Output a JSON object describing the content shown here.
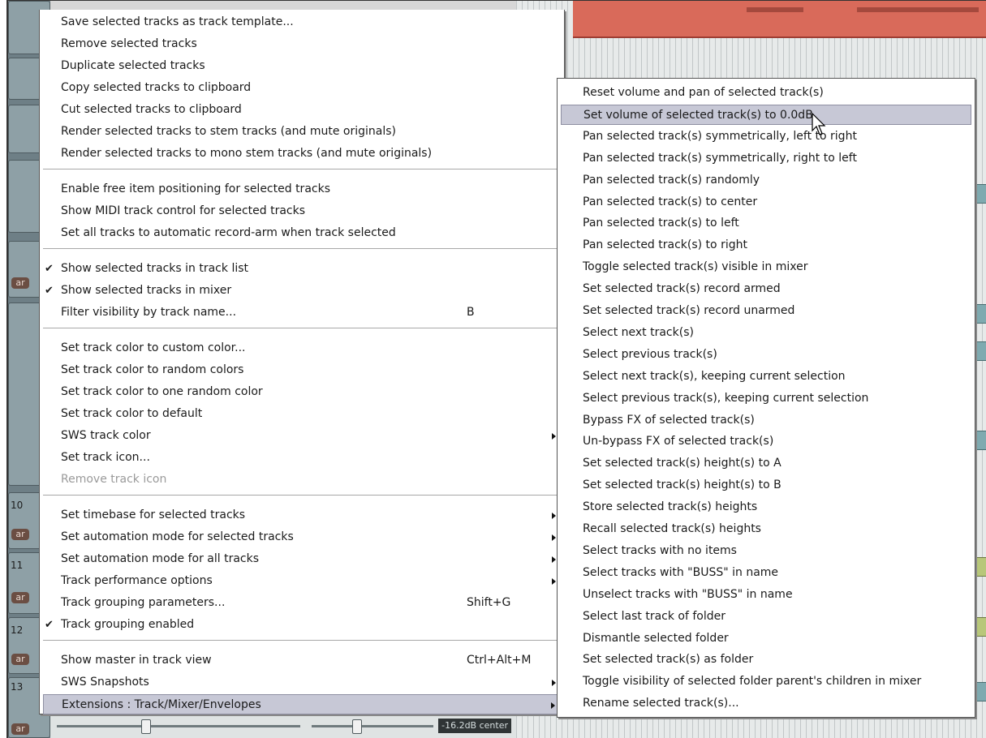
{
  "tcp": {
    "track_numbers": [
      "10",
      "11",
      "12",
      "13"
    ],
    "arm_label": "ar"
  },
  "bottom_strip": {
    "readout": "-16.2dB center"
  },
  "main_menu": {
    "items": [
      {
        "label": "Save selected tracks as track template..."
      },
      {
        "label": "Remove selected tracks"
      },
      {
        "label": "Duplicate selected tracks"
      },
      {
        "label": "Copy selected tracks to clipboard"
      },
      {
        "label": "Cut selected tracks to clipboard"
      },
      {
        "label": "Render selected tracks to stem tracks (and mute originals)"
      },
      {
        "label": "Render selected tracks to mono stem tracks (and mute originals)"
      },
      {
        "label": "Enable free item positioning for selected tracks"
      },
      {
        "label": "Show MIDI track control for selected tracks"
      },
      {
        "label": "Set all tracks to automatic record-arm when track selected"
      },
      {
        "label": "Show selected tracks in track list",
        "checked": true
      },
      {
        "label": "Show selected tracks in mixer",
        "checked": true
      },
      {
        "label": "Filter visibility by track name...",
        "shortcut": "B"
      },
      {
        "label": "Set track color to custom color..."
      },
      {
        "label": "Set track color to random colors"
      },
      {
        "label": "Set track color to one random color"
      },
      {
        "label": "Set track color to default"
      },
      {
        "label": "SWS track color",
        "submenu": true
      },
      {
        "label": "Set track icon..."
      },
      {
        "label": "Remove track icon",
        "disabled": true
      },
      {
        "label": "Set timebase for selected tracks",
        "submenu": true
      },
      {
        "label": "Set automation mode for selected tracks",
        "submenu": true
      },
      {
        "label": "Set automation mode for all tracks",
        "submenu": true
      },
      {
        "label": "Track performance options",
        "submenu": true
      },
      {
        "label": "Track grouping parameters...",
        "shortcut": "Shift+G"
      },
      {
        "label": "Track grouping enabled",
        "checked": true
      },
      {
        "label": "Show master in track view",
        "shortcut": "Ctrl+Alt+M"
      },
      {
        "label": "SWS Snapshots",
        "submenu": true
      },
      {
        "label": "Extensions : Track/Mixer/Envelopes",
        "submenu": true,
        "highlighted": true
      }
    ],
    "checkmark_glyph": "✔"
  },
  "sub_menu": {
    "items": [
      {
        "label": "Reset volume and pan of selected track(s)"
      },
      {
        "label": "Set volume of selected track(s) to 0.0dB",
        "highlighted": true
      },
      {
        "label": "Pan selected track(s) symmetrically, left to right"
      },
      {
        "label": "Pan selected track(s) symmetrically, right to left"
      },
      {
        "label": "Pan selected track(s) randomly"
      },
      {
        "label": "Pan selected track(s) to center"
      },
      {
        "label": "Pan selected track(s) to left"
      },
      {
        "label": "Pan selected track(s) to right"
      },
      {
        "label": "Toggle selected track(s) visible in mixer"
      },
      {
        "label": "Set selected track(s) record armed"
      },
      {
        "label": "Set selected track(s) record unarmed"
      },
      {
        "label": "Select next track(s)"
      },
      {
        "label": "Select previous track(s)"
      },
      {
        "label": "Select next track(s), keeping current selection"
      },
      {
        "label": "Select previous track(s), keeping current selection"
      },
      {
        "label": "Bypass FX of selected track(s)"
      },
      {
        "label": "Un-bypass FX of selected track(s)"
      },
      {
        "label": "Set selected track(s) height(s) to A"
      },
      {
        "label": "Set selected track(s) height(s) to B"
      },
      {
        "label": "Store selected track(s) heights"
      },
      {
        "label": "Recall selected track(s) heights"
      },
      {
        "label": "Select tracks with no items"
      },
      {
        "label": "Select tracks with \"BUSS\" in name"
      },
      {
        "label": "Unselect tracks with \"BUSS\" in name"
      },
      {
        "label": "Select last track of folder"
      },
      {
        "label": "Dismantle selected folder"
      },
      {
        "label": "Set selected track(s) as folder"
      },
      {
        "label": "Toggle visibility of selected folder parent's children in mixer"
      },
      {
        "label": "Rename selected track(s)..."
      }
    ]
  },
  "colors": {
    "menu_highlight": "#c7c8d6",
    "region_red": "#d96a5a",
    "track_panel": "#8ea0a6"
  },
  "icons": [
    "checkmark-icon",
    "submenu-arrow-icon",
    "mouse-cursor-icon"
  ]
}
